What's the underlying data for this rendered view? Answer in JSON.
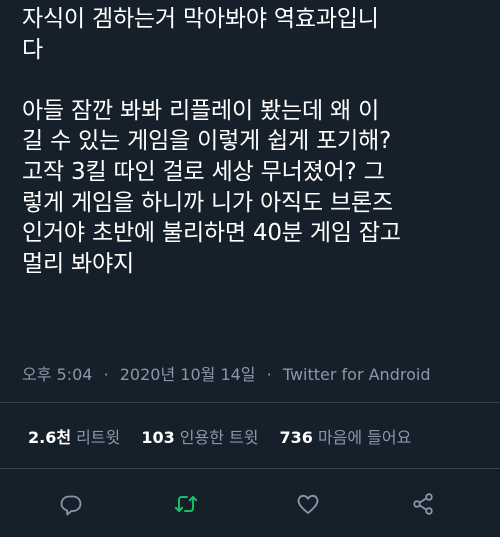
{
  "tweet": {
    "lines": [
      "자식이 겜하는거 막아봐야 역효과입니",
      "다",
      "",
      "아들 잠깐 봐봐 리플레이 봤는데 왜 이",
      "길 수 있는 게임을 이렇게 쉽게 포기해?",
      "고작 3킬 따인 걸로 세상 무너졌어? 그",
      "렇게 게임을 하니까 니가 아직도 브론즈",
      "인거야 초반에 불리하면 40분 게임 잡고",
      "멀리 봐야지"
    ],
    "time": "오후 5:04",
    "separator": "·",
    "date": "2020년 10월 14일",
    "client": "Twitter for Android"
  },
  "stats": {
    "retweets": {
      "count": "2.6천",
      "label": "리트윗"
    },
    "quotes": {
      "count": "103",
      "label": "인용한 트윗"
    },
    "likes": {
      "count": "736",
      "label": "마음에 들어요"
    }
  },
  "actions": {
    "reply": {
      "icon": "reply-icon",
      "color": "#8899a6"
    },
    "retweet": {
      "icon": "retweet-icon",
      "color": "#17bf63"
    },
    "like": {
      "icon": "heart-icon",
      "color": "#8899a6"
    },
    "share": {
      "icon": "share-icon",
      "color": "#8899a6"
    }
  },
  "colors": {
    "background": "#15202b",
    "text": "#ffffff",
    "secondary": "#8899a6",
    "divider": "#38444d",
    "retweet_active": "#17bf63"
  }
}
